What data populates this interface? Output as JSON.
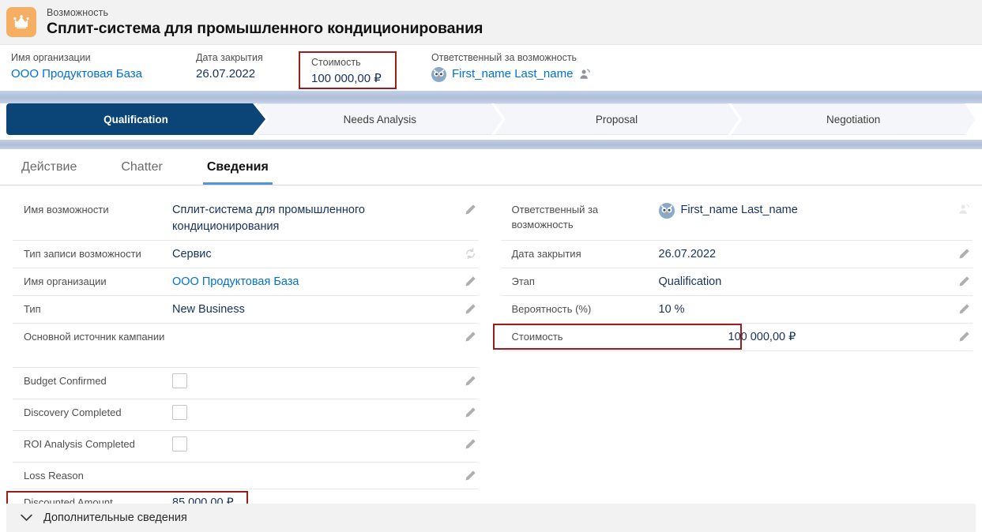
{
  "header": {
    "icon": "crown-icon",
    "icon_bg": "#f5ae62",
    "eyebrow": "Возможность",
    "title": "Сплит-система для промышленного кондиционирования"
  },
  "info_bar": {
    "fields": [
      {
        "label": "Имя организации",
        "value": "ООО Продуктовая База",
        "is_link": true
      },
      {
        "label": "Дата закрытия",
        "value": "26.07.2022",
        "is_link": false
      },
      {
        "label": "Стоимость",
        "value": "100 000,00 ₽",
        "is_link": false,
        "highlighted": true
      },
      {
        "label": "Ответственный за возможность",
        "value": "First_name Last_name",
        "is_link": true,
        "has_avatar": true,
        "has_follow_icon": true
      }
    ]
  },
  "path": {
    "stages": [
      {
        "label": "Qualification",
        "state": "current"
      },
      {
        "label": "Needs Analysis",
        "state": "upcoming"
      },
      {
        "label": "Proposal",
        "state": "upcoming"
      },
      {
        "label": "Negotiation",
        "state": "upcoming"
      }
    ],
    "current_color": "#0b4577",
    "upcoming_color": "#f4f6f9"
  },
  "tabs": [
    {
      "label": "Действие",
      "active": false
    },
    {
      "label": "Chatter",
      "active": false
    },
    {
      "label": "Сведения",
      "active": true
    }
  ],
  "details": {
    "left_column": [
      {
        "label": "Имя возможности",
        "value": "Сплит-система для промышленного кондиционирования",
        "type": "text",
        "editable": true,
        "tall": true
      },
      {
        "label": "Тип записи возможности",
        "value": "Сервис",
        "type": "text",
        "editable": false,
        "locked": true
      },
      {
        "label": "Имя организации",
        "value": "ООО Продуктовая База",
        "type": "link",
        "editable": true
      },
      {
        "label": "Тип",
        "value": "New Business",
        "type": "text",
        "editable": true
      },
      {
        "label": "Основной источник кампании",
        "value": "",
        "type": "text",
        "editable": true,
        "tall": true
      },
      {
        "label": "Budget Confirmed",
        "value": "",
        "type": "checkbox",
        "checked": false,
        "editable": true
      },
      {
        "label": "Discovery Completed",
        "value": "",
        "type": "checkbox",
        "checked": false,
        "editable": true
      },
      {
        "label": "ROI Analysis Completed",
        "value": "",
        "type": "checkbox",
        "checked": false,
        "editable": true
      },
      {
        "label": "Loss Reason",
        "value": "",
        "type": "text",
        "editable": true
      },
      {
        "label": "Discounted Amount",
        "value": "85 000,00 ₽",
        "type": "text",
        "editable": false,
        "highlighted": true
      }
    ],
    "right_column": [
      {
        "label": "Ответственный за возможность",
        "value": "First_name Last_name",
        "type": "owner",
        "editable": false,
        "locked": true,
        "tall": true
      },
      {
        "label": "Дата закрытия",
        "value": "26.07.2022",
        "type": "text",
        "editable": true
      },
      {
        "label": "Этап",
        "value": "Qualification",
        "type": "text",
        "editable": true
      },
      {
        "label": "Вероятность (%)",
        "value": "10 %",
        "type": "text",
        "editable": true
      },
      {
        "label": "Стоимость",
        "value": "100 000,00 ₽",
        "type": "money",
        "editable": true,
        "highlighted": true
      }
    ]
  },
  "footer_section": {
    "label": "Дополнительные сведения",
    "icon": "chevron-down-icon",
    "expanded": true
  },
  "colors": {
    "highlight_border": "#9c1b1b",
    "link": "#0070d2",
    "path_active": "#0b4577",
    "tab_underline": "#5596d8",
    "brand_icon": "#f5ae62"
  }
}
